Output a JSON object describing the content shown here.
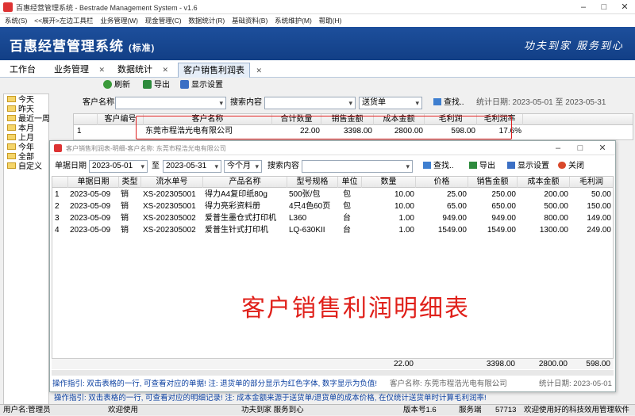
{
  "window": {
    "title": "百惠经营管理系统 - Bestrade Management System - v1.6"
  },
  "menu": [
    "系统(S)",
    "<<展开>左边工具栏",
    "业务管理(W)",
    "现金管理(C)",
    "数据统计(R)",
    "基础资料(B)",
    "系统维护(M)",
    "帮助(H)"
  ],
  "banner": {
    "brand": "百惠经营管理系统",
    "edition": "(标准)",
    "slogan": "功夫到家  服务到心"
  },
  "tabs": [
    {
      "label": "工作台",
      "closable": false
    },
    {
      "label": "业务管理",
      "closable": true
    },
    {
      "label": "数据统计",
      "closable": true
    },
    {
      "label": "客户销售利润表",
      "closable": true,
      "active": true
    }
  ],
  "toolbar": {
    "refresh": "刷新",
    "export": "导出",
    "display": "显示设置"
  },
  "tree": [
    "今天",
    "昨天",
    "最近一周",
    "本月",
    "上月",
    "今年",
    "全部",
    "自定义"
  ],
  "filter": {
    "customer_label": "客户名称",
    "customer_value": "",
    "search_label": "搜索内容",
    "search_value": "",
    "type_value": "送货单",
    "search_btn": "查找..",
    "date_stat": "统计日期: 2023-05-01 至 2023-05-31"
  },
  "main_grid": {
    "headers": [
      "客户编号",
      "客户名称",
      "合计数量",
      "销售金额",
      "成本金额",
      "毛利润",
      "毛利润率"
    ],
    "rows": [
      {
        "no": "1",
        "code": "",
        "name": "东莞市程浩光电有限公司",
        "qty": "22.00",
        "sales": "3398.00",
        "cost": "2800.00",
        "profit": "598.00",
        "rate": "17.6%"
      }
    ]
  },
  "popup": {
    "title": "客户销售利润表-明细-客户名称: 东莞市程浩光电有限公司",
    "date_label": "单据日期",
    "date_from": "2023-05-01",
    "to": "至",
    "date_to": "2023-05-31",
    "period": "今个月",
    "search_label": "搜索内容",
    "search_value": "",
    "find": "查找..",
    "export": "导出",
    "display": "显示设置",
    "close": "关闭",
    "headers": [
      "单据日期",
      "类型",
      "流水单号",
      "产品名称",
      "型号规格",
      "单位",
      "数量",
      "价格",
      "销售金额",
      "成本金额",
      "毛利润"
    ],
    "rows": [
      [
        "1",
        "2023-05-09",
        "销",
        "XS-202305001",
        "得力A4复印纸80g",
        "500张/包",
        "包",
        "10.00",
        "25.00",
        "250.00",
        "200.00",
        "50.00"
      ],
      [
        "2",
        "2023-05-09",
        "销",
        "XS-202305001",
        "得力亮彩资料册",
        "4只4色60页",
        "包",
        "10.00",
        "65.00",
        "650.00",
        "500.00",
        "150.00"
      ],
      [
        "3",
        "2023-05-09",
        "销",
        "XS-202305002",
        "爱普生墨仓式打印机",
        "L360",
        "台",
        "1.00",
        "949.00",
        "949.00",
        "800.00",
        "149.00"
      ],
      [
        "4",
        "2023-05-09",
        "销",
        "XS-202305002",
        "爱普生针式打印机",
        "LQ-630KII",
        "台",
        "1.00",
        "1549.00",
        "1549.00",
        "1300.00",
        "249.00"
      ]
    ],
    "overlay_text": "客户销售利润明细表",
    "totals": {
      "qty": "22.00",
      "sales": "3398.00",
      "cost": "2800.00",
      "profit": "598.00"
    },
    "hint": "操作指引: 双击表格的一行, 可查看对应的单据! 注: 退货单的部分显示为红色字体, 数字显示为负值!",
    "status_customer": "客户名称: 东莞市程浩光电有限公司",
    "status_date": "统计日期: 2023-05-01"
  },
  "bottom_hint": "操作指引: 双击表格的一行, 可查看对应的明细记录! 注: 成本金额来源于送货单/退货单的成本价格, 在仅统计送货单时计算毛利润率!",
  "statusbar": {
    "user": "用户名:管理员",
    "welcome": "欢迎使用",
    "slogan": "功夫到家 服务到心",
    "version": "版本号1.6",
    "server": "服务端",
    "port": "57713",
    "msg": "欢迎使用好的科技效用管理软件"
  },
  "colors": {
    "banner": "#1d4f9c",
    "highlight_box": "#e02020",
    "hint_text": "#0a3fa0",
    "overlay_text": "#e0201a"
  }
}
